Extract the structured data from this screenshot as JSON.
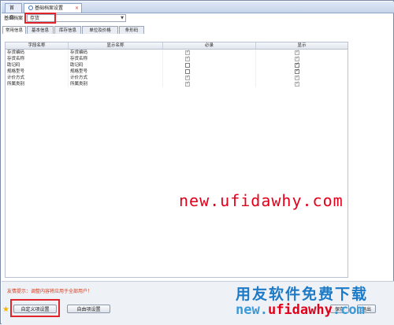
{
  "tabs": [
    {
      "label": "首页"
    },
    {
      "label": "基础档案设置",
      "close": "×"
    }
  ],
  "archive": {
    "label": "基础档案",
    "value": "存货"
  },
  "subtabs": [
    "常用信息",
    "基本信息",
    "库存信息",
    "单位及价格",
    "条形码"
  ],
  "grid": {
    "headers": [
      "字段名称",
      "显示名称",
      "必录",
      "显示"
    ],
    "rows": [
      {
        "field": "存货编码",
        "display": "存货编码",
        "required": true,
        "required_disabled": true,
        "show": true,
        "show_disabled": true
      },
      {
        "field": "存货名称",
        "display": "存货名称",
        "required": true,
        "required_disabled": true,
        "show": true,
        "show_disabled": true
      },
      {
        "field": "助记码",
        "display": "助记码",
        "required": false,
        "required_disabled": false,
        "show": true,
        "show_disabled": false
      },
      {
        "field": "规格型号",
        "display": "规格型号",
        "required": false,
        "required_disabled": false,
        "show": true,
        "show_disabled": false
      },
      {
        "field": "计价方式",
        "display": "计价方式",
        "required": true,
        "required_disabled": true,
        "show": true,
        "show_disabled": true
      },
      {
        "field": "所属类别",
        "display": "所属类别",
        "required": true,
        "required_disabled": true,
        "show": true,
        "show_disabled": true
      }
    ]
  },
  "watermark": "new.ufidawhy.com",
  "tip": "友情提示：调整内容将应用于全部用户！",
  "buttons": {
    "custom": "自定义项设置",
    "free": "自由项设置",
    "save": "保存",
    "cancel": "退出"
  },
  "brand": {
    "title": "用友软件免费下载",
    "url_prefix": "new.",
    "url_mid": "ufidawhy",
    "url_suffix": ".com"
  },
  "colors": {
    "highlight": "#e0242a",
    "watermark": "#e3001b",
    "brand": "#1d7ac6"
  }
}
